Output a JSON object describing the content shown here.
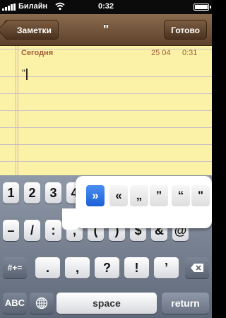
{
  "status": {
    "carrier": "Билайн",
    "time": "0:32"
  },
  "nav": {
    "back": "Заметки",
    "title": "\"",
    "done": "Готово"
  },
  "note": {
    "date_label": "Сегодня",
    "date": "25 04",
    "time": "0:31",
    "text": "\""
  },
  "keyboard": {
    "row1": [
      "1",
      "2",
      "3",
      "4"
    ],
    "row2": [
      "–",
      "/",
      ":",
      ";",
      "(",
      ")",
      "$",
      "&",
      "@"
    ],
    "row3_left": "#+=",
    "row3": [
      ".",
      ",",
      "?",
      "!",
      "’"
    ],
    "abc": "ABC",
    "space": "space",
    "return": "return",
    "popup": [
      "»",
      "«",
      "„",
      "”",
      "“",
      "\""
    ]
  }
}
